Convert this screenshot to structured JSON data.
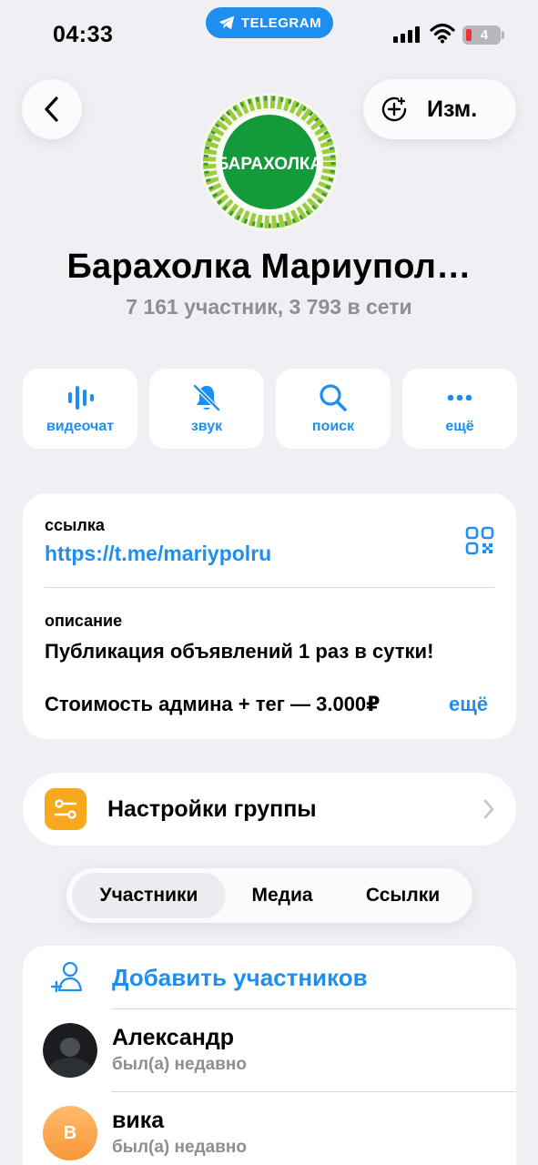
{
  "status_bar": {
    "time": "04:33",
    "pill_label": "TELEGRAM",
    "battery": "4"
  },
  "header": {
    "back_icon": "chevron-left-icon",
    "edit_label": "Изм.",
    "add_icon": "circle-plus-icon"
  },
  "group": {
    "avatar_text": "БАРАХОЛКА",
    "title": "Барахолка Мариупол…",
    "subtitle": "7 161 участник, 3 793 в сети"
  },
  "actions": [
    {
      "label": "видеочат",
      "icon": "waveform-icon"
    },
    {
      "label": "звук",
      "icon": "bell-slash-icon"
    },
    {
      "label": "поиск",
      "icon": "search-icon"
    },
    {
      "label": "ещё",
      "icon": "more-dots-icon"
    }
  ],
  "info": {
    "link_label": "ссылка",
    "link_value": "https://t.me/mariypolru",
    "desc_label": "описание",
    "desc_line1": "Публикация объявлений 1 раз в сутки!",
    "desc_line2": "Стоимость админа + тег — 3.000₽",
    "more_label": "ещё"
  },
  "settings": {
    "label": "Настройки группы"
  },
  "tabs": [
    {
      "label": "Участники",
      "active": true
    },
    {
      "label": "Медиа",
      "active": false
    },
    {
      "label": "Ссылки",
      "active": false
    }
  ],
  "members": {
    "add_label": "Добавить участников",
    "list": [
      {
        "name": "Александр",
        "status": "был(а) недавно",
        "avatar": "photo"
      },
      {
        "name": "вика",
        "status": "был(а) недавно",
        "avatar": "В"
      }
    ]
  },
  "colors": {
    "accent": "#1e8ff0",
    "background": "#efeff4",
    "settings_icon": "#f7a91e"
  }
}
